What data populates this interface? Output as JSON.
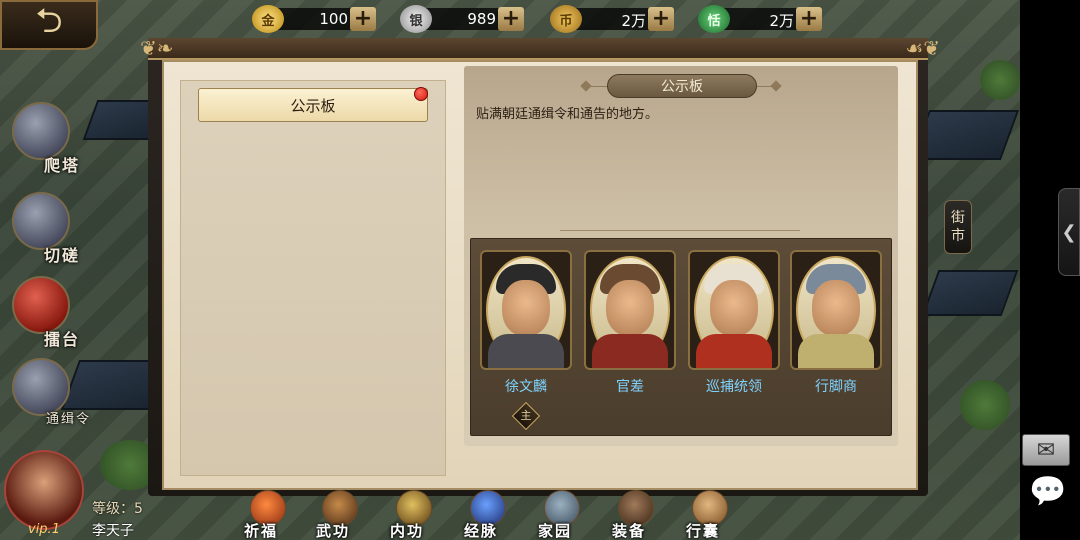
{
  "top": {
    "back_icon": "back-arrow-icon",
    "resources": [
      {
        "name": "gold-ingot",
        "icon_glyph": "金",
        "value": "100",
        "plus": "+"
      },
      {
        "name": "silver",
        "icon_glyph": "银",
        "value": "989",
        "plus": "+"
      },
      {
        "name": "copper-coin",
        "icon_glyph": "币",
        "value": "2万",
        "plus": "+"
      },
      {
        "name": "jade-token",
        "icon_glyph": "恬",
        "value": "2万",
        "plus": "+"
      }
    ]
  },
  "left_menu": [
    {
      "label": "爬塔",
      "icon": "tower-icon"
    },
    {
      "label": "切磋",
      "icon": "spar-icon"
    },
    {
      "label": "擂台",
      "icon": "arena-icon"
    },
    {
      "label": "通缉令",
      "icon": "wanted-icon"
    }
  ],
  "panel": {
    "tab_label": "公示板",
    "title": "公示板",
    "description": "贴满朝廷通缉令和通告的地方。",
    "npcs": [
      {
        "name": "徐文麟",
        "hat": "#2a2a2a",
        "body": "#4a4a50"
      },
      {
        "name": "官差",
        "hat": "#6a4a30",
        "body": "#8a2a20"
      },
      {
        "name": "巡捕统领",
        "hat": "#e8e0d0",
        "body": "#b03020"
      },
      {
        "name": "行脚商",
        "hat": "#7a8a9a",
        "body": "#c0b070"
      }
    ],
    "master_badge": "主"
  },
  "player": {
    "level": "等级：5",
    "name": "李天子",
    "vip": "vip.1"
  },
  "bottom_menu": [
    "祈福",
    "武功",
    "内功",
    "经脉",
    "家园",
    "装备",
    "行囊"
  ],
  "right_side": {
    "street_label_1": "街",
    "street_label_2": "市",
    "arrow": "❮",
    "mail": "✉",
    "chat": "💬"
  },
  "colors": {
    "npc_name": "#7fd3ff",
    "red_dot": "#d21a0f"
  }
}
